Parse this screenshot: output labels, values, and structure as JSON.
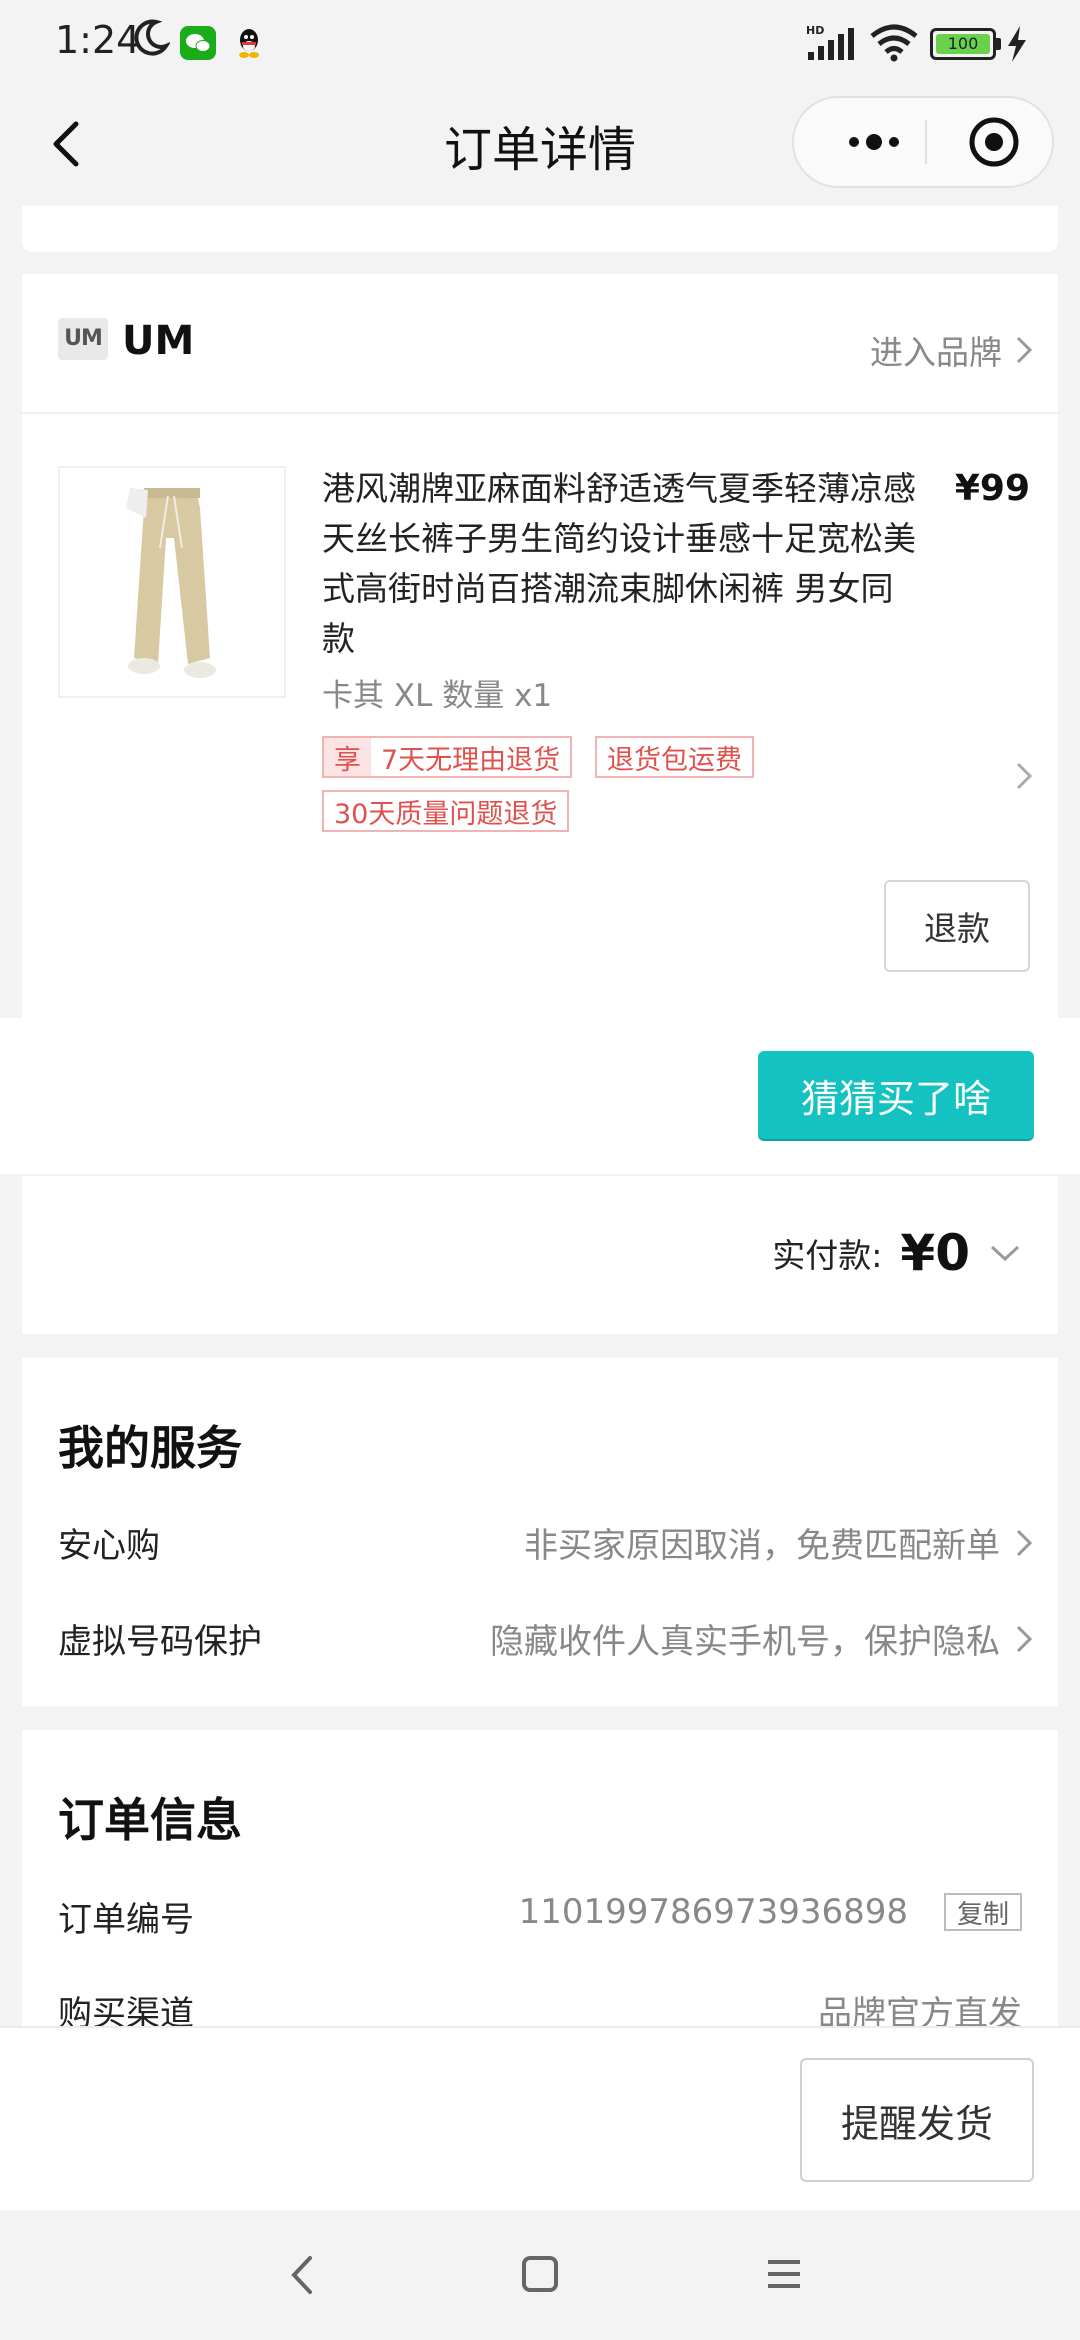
{
  "status_bar": {
    "time": "1:24",
    "battery": "100",
    "network": "HD"
  },
  "nav": {
    "title": "订单详情"
  },
  "brand": {
    "logo_text": "UM",
    "name": "UM",
    "link_label": "进入品牌"
  },
  "product": {
    "title": "港风潮牌亚麻面料舒适透气夏季轻薄凉感天丝长裤子男生简约设计垂感十足宽松美式高街时尚百搭潮流束脚休闲裤 男女同款",
    "price": "¥99",
    "spec": "卡其 XL 数量 x1",
    "tags": [
      {
        "prefix": "享",
        "text": "7天无理由退货"
      },
      {
        "text": "退货包运费"
      },
      {
        "text": "30天质量问题退货"
      }
    ],
    "refund_label": "退款"
  },
  "guess_button": "猜猜买了啥",
  "payment": {
    "label": "实付款:",
    "value": "¥0"
  },
  "services": {
    "title": "我的服务",
    "rows": [
      {
        "label": "安心购",
        "value": "非买家原因取消，免费匹配新单"
      },
      {
        "label": "虚拟号码保护",
        "value": "隐藏收件人真实手机号，保护隐私"
      }
    ]
  },
  "order_info": {
    "title": "订单信息",
    "rows": [
      {
        "label": "订单编号",
        "value": "110199786973936898",
        "action": "复制"
      },
      {
        "label": "购买渠道",
        "value": "品牌官方直发"
      }
    ]
  },
  "bottom": {
    "remind_label": "提醒发货"
  },
  "colors": {
    "accent": "#14c2c2",
    "tag_red": "#e0514d",
    "battery_green": "#6bd14a",
    "wechat_green": "#1aad19"
  }
}
